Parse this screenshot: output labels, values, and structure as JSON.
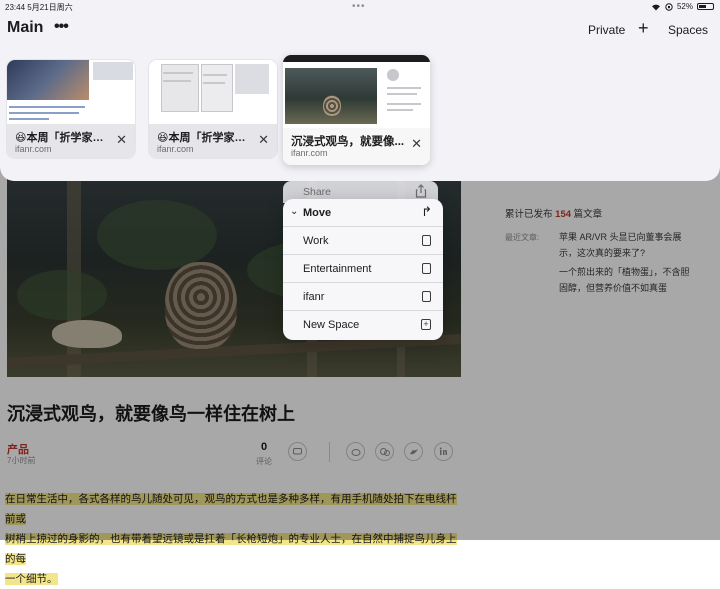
{
  "status_bar": {
    "time_date": "23:44  5月21日周六",
    "battery": "52%"
  },
  "header": {
    "space_title": "Main",
    "more": "•••",
    "private": "Private",
    "add": "+",
    "spaces": "Spaces"
  },
  "tabs": [
    {
      "title": "😆本周「折学家」...",
      "domain": "ifanr.com",
      "close": "✕"
    },
    {
      "title": "😆本周「折学家」...",
      "domain": "ifanr.com",
      "close": "✕"
    },
    {
      "title": "沉浸式观鸟，就要像...",
      "domain": "ifanr.com",
      "close": "✕"
    }
  ],
  "context_menu": {
    "share": "Share",
    "move": "Move",
    "items": [
      "Work",
      "Entertainment",
      "ifanr",
      "New Space"
    ]
  },
  "article": {
    "title": "沉浸式观鸟，就要像鸟一样住在树上",
    "category": "产品",
    "time_ago": "7小时前",
    "comment_count": "0",
    "comment_label": "评论",
    "highlight_lines": [
      "在日常生活中，各式各样的鸟儿随处可见，观鸟的方式也是多种多样，有用手机随处拍下在电线杆前或",
      "树梢上掠过的身影的，也有带着望远镜或是扛着「长枪短炮」的专业人士，在自然中捕捉鸟儿身上的每",
      "一个细节。"
    ]
  },
  "sidebar": {
    "stats_prefix": "累计已发布",
    "stats_count": "154",
    "stats_suffix": "篇文章",
    "latest_label": "最近文章:",
    "latest_items": [
      "苹果 AR/VR 头显已向董事会展示，这次真的要来了?",
      "一个煎出来的「植物蛋」，不含胆固醇，但营养价值不如真蛋"
    ]
  }
}
